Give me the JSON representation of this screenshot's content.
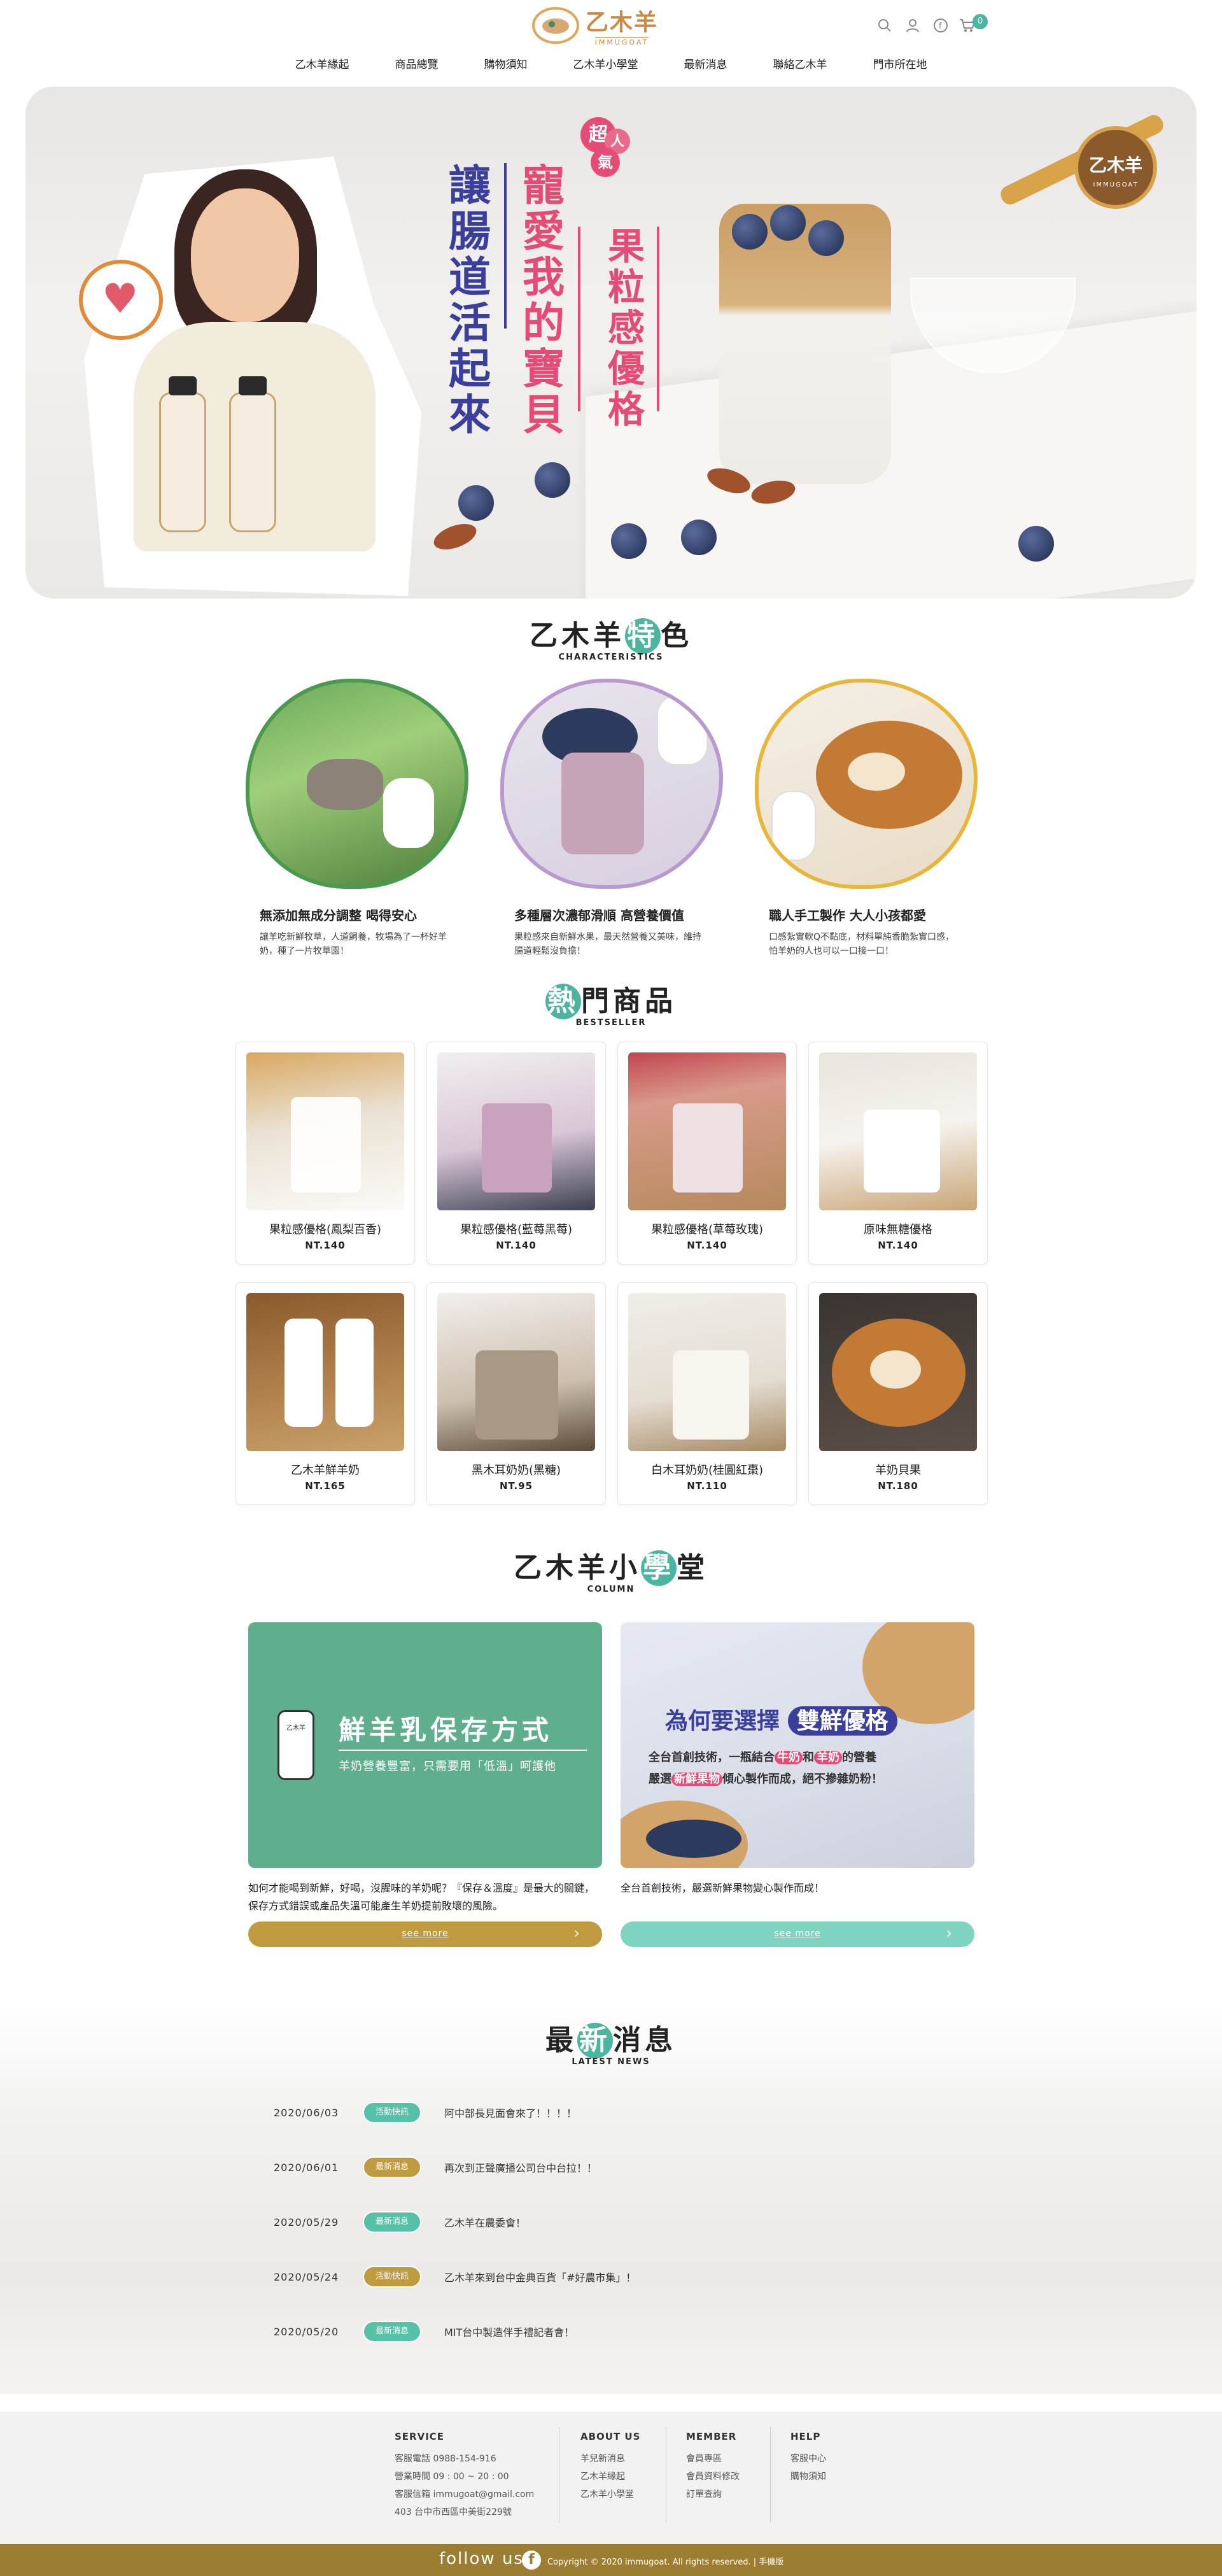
{
  "header": {
    "logo_zh": "乙木羊",
    "logo_en": "IMMUGOAT",
    "cart_count": "0",
    "icons": [
      "search-icon",
      "user-icon",
      "facebook-icon",
      "cart-icon"
    ],
    "nav": [
      "乙木羊緣起",
      "商品總覽",
      "購物須知",
      "乙木羊小學堂",
      "最新消息",
      "聯絡乙木羊",
      "門市所在地"
    ]
  },
  "hero": {
    "badge_super": [
      "超",
      "人",
      "氣"
    ],
    "line1": "讓腸道活起來",
    "line2": "寵愛我的寶貝",
    "line3": "果粒感優格",
    "brand_zh": "乙木羊",
    "brand_en": "IMMUGOAT",
    "colors": {
      "blue": "#3b3f9c",
      "pink": "#e44b75"
    }
  },
  "features": {
    "title_pre": "乙木羊",
    "title_hl": "特",
    "title_post": "色",
    "title_en": "CHARACTERISTICS",
    "items": [
      {
        "title": "無添加無成分調整 喝得安心",
        "desc": "讓羊吃新鮮牧草，人道飼養，牧場為了一杯好羊奶，種了一片牧草園！",
        "border": "#4a9a4e"
      },
      {
        "title": "多種層次濃郁滑順 高營養價值",
        "desc": "果粒感來自新鮮水果，最天然營養又美味，維持腸道輕鬆沒負擔！",
        "border": "#b99ad0"
      },
      {
        "title": "職人手工製作 大人小孩都愛",
        "desc": "口感紮實軟Q不黏底，材料單純香脆紮實口感，怕羊奶的人也可以一口接一口！",
        "border": "#e8b63a"
      }
    ]
  },
  "bestseller": {
    "title_hl": "熱",
    "title_post": "門商品",
    "title_en": "BESTSELLER",
    "items": [
      {
        "name": "果粒感優格(鳳梨百香)",
        "price": "NT.140"
      },
      {
        "name": "果粒感優格(藍莓黑莓)",
        "price": "NT.140"
      },
      {
        "name": "果粒感優格(草莓玫瑰)",
        "price": "NT.140"
      },
      {
        "name": "原味無糖優格",
        "price": "NT.140"
      },
      {
        "name": "乙木羊鮮羊奶",
        "price": "NT.165"
      },
      {
        "name": "黑木耳奶奶(黑糖)",
        "price": "NT.95"
      },
      {
        "name": "白木耳奶奶(桂圓紅棗)",
        "price": "NT.110"
      },
      {
        "name": "羊奶貝果",
        "price": "NT.180"
      }
    ]
  },
  "column": {
    "title_pre": "乙木羊小",
    "title_hl": "學",
    "title_post": "堂",
    "title_en": "COLUMN",
    "cards": [
      {
        "img_title": "鮮羊乳保存方式",
        "img_sub": "羊奶營養豐富，只需要用「低溫」呵護他",
        "bottle_label": "乙木羊",
        "desc": "如何才能喝到新鮮，好喝，沒腥味的羊奶呢？『保存＆溫度』是最大的關鍵，保存方式錯誤或產品失溫可能產生羊奶提前敗壞的風險。",
        "button": "see more",
        "button_color": "#bf9a3e"
      },
      {
        "img_title_pre": "為何要選擇",
        "img_title_hl": "雙鮮優格",
        "img_l1a": "全台首創技術，一瓶結合",
        "img_l1b": "牛奶",
        "img_l1c": "和",
        "img_l1d": "羊奶",
        "img_l1e": "的營養",
        "img_l2a": "嚴選",
        "img_l2b": "新鮮果物",
        "img_l2c": "傾心製作而成，絕不摻雜奶粉！",
        "desc": "全台首創技術，嚴選新鮮果物變心製作而成！",
        "button": "see more",
        "button_color": "#7fd4c1"
      }
    ]
  },
  "news": {
    "title_pre": "最",
    "title_hl": "新",
    "title_post": "消息",
    "title_en": "LATEST NEWS",
    "items": [
      {
        "date": "2020/06/03",
        "tag": "活動快訊",
        "tag_color": "#57c1a7",
        "title": "阿中部長見面會來了！！！！"
      },
      {
        "date": "2020/06/01",
        "tag": "最新消息",
        "tag_color": "#bf9a3e",
        "title": "再次到正聲廣播公司台中台拉！！"
      },
      {
        "date": "2020/05/29",
        "tag": "最新消息",
        "tag_color": "#57c1a7",
        "title": "乙木羊在農委會！"
      },
      {
        "date": "2020/05/24",
        "tag": "活動快訊",
        "tag_color": "#bf9a3e",
        "title": "乙木羊來到台中金典百貨「#好農市集」！"
      },
      {
        "date": "2020/05/20",
        "tag": "最新消息",
        "tag_color": "#57c1a7",
        "title": "MIT台中製造伴手禮記者會！"
      }
    ]
  },
  "footer": {
    "service": {
      "title": "SERVICE",
      "lines": [
        "客服電話 0988-154-916",
        "營業時間 09 : 00 ~ 20 : 00",
        "客服信箱 immugoat@gmail.com",
        "403 台中市西區中美街229號"
      ]
    },
    "about": {
      "title": "ABOUT US",
      "lines": [
        "羊兒新消息",
        "乙木羊緣起",
        "乙木羊小學堂"
      ]
    },
    "member": {
      "title": "MEMBER",
      "lines": [
        "會員專區",
        "會員資料修改",
        "訂單查詢"
      ]
    },
    "help": {
      "title": "HELP",
      "lines": [
        "客服中心",
        "購物須知"
      ]
    },
    "follow": "follow us",
    "fb": "f",
    "copyright": "Copyright © 2020 immugoat. All rights reserved. | 手機版"
  }
}
